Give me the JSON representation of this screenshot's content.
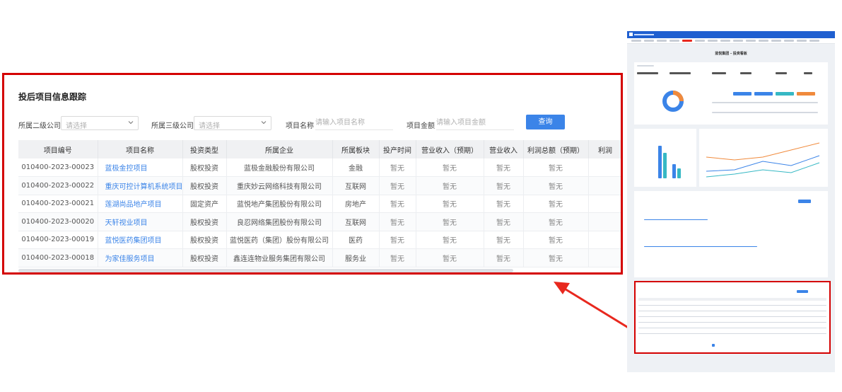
{
  "panel": {
    "title": "投后项目信息跟踪",
    "filters": {
      "level2_label": "所属二级公司",
      "level2_placeholder": "请选择",
      "level3_label": "所属三级公司",
      "level3_placeholder": "请选择",
      "name_label": "项目名称",
      "name_placeholder": "请输入项目名称",
      "amount_label": "项目金额",
      "amount_placeholder": "请输入项目金额",
      "query_label": "查询"
    },
    "columns": [
      "项目编号",
      "项目名称",
      "投资类型",
      "所属企业",
      "所属板块",
      "投产时间",
      "营业收入（预期）",
      "营业收入",
      "利润总额（预期）",
      "利润"
    ],
    "rows": [
      [
        "010400-2023-00023",
        "蓝极金控项目",
        "股权投资",
        "蓝极金融股份有限公司",
        "金融",
        "暂无",
        "暂无",
        "暂无",
        "暂无"
      ],
      [
        "010400-2023-00022",
        "重庆可控计算机系统项目",
        "股权投资",
        "重庆妙云网络科技有限公司",
        "互联网",
        "暂无",
        "暂无",
        "暂无",
        "暂无"
      ],
      [
        "010400-2023-00021",
        "莲湖尚品地产项目",
        "固定资产",
        "蓝悦地产集团股份有限公司",
        "房地产",
        "暂无",
        "暂无",
        "暂无",
        "暂无"
      ],
      [
        "010400-2023-00020",
        "天轩视业项目",
        "股权投资",
        "良忍网络集团股份有限公司",
        "互联网",
        "暂无",
        "暂无",
        "暂无",
        "暂无"
      ],
      [
        "010400-2023-00019",
        "蓝悦医药集团项目",
        "股权投资",
        "蓝悦医药（集团）股份有限公司",
        "医药",
        "暂无",
        "暂无",
        "暂无",
        "暂无"
      ],
      [
        "010400-2023-00018",
        "为家佳服务项目",
        "股权投资",
        "鑫连连物业服务集团有限公司",
        "服务业",
        "暂无",
        "暂无",
        "暂无",
        "暂无"
      ]
    ]
  },
  "thumbnail": {
    "page_title": "蓝悦集团 - 投资看板"
  },
  "colors": {
    "highlight": "#d40000",
    "accent": "#3b84e8"
  }
}
